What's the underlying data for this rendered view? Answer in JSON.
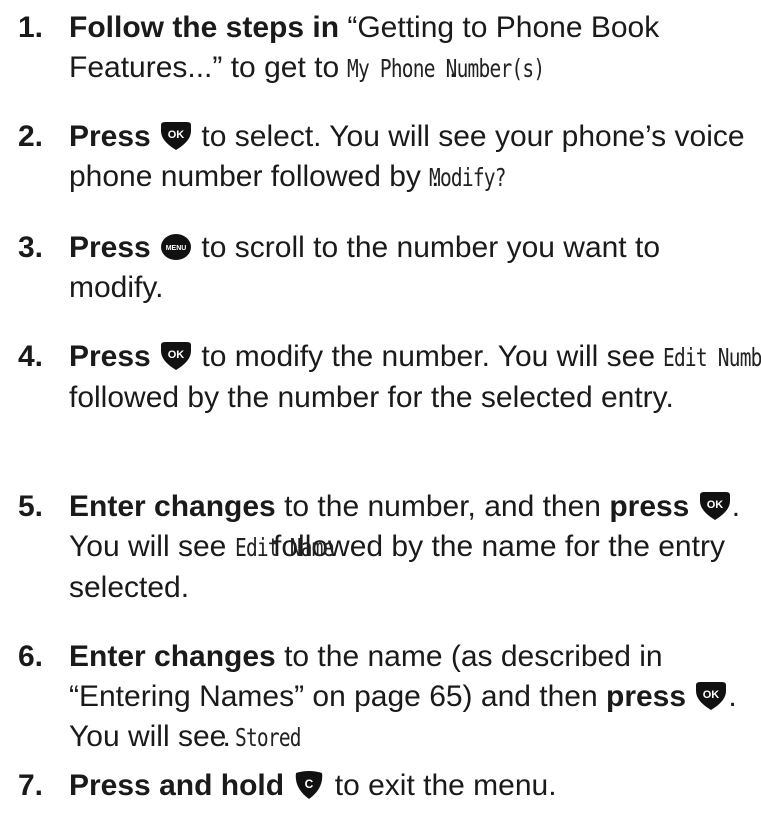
{
  "steps": [
    {
      "number": "1.",
      "bold": "Follow the steps in",
      "text_a": " “Getting to Phone Book Features...” to get to ",
      "lcd": "My Phone Number(s)",
      "text_b": "."
    },
    {
      "number": "2.",
      "bold": "Press",
      "icon": "ok-key-icon",
      "text_a": " to select. You will see your phone’s voice phone number followed by ",
      "lcd": "Modify?",
      "text_b": "."
    },
    {
      "number": "3.",
      "bold": "Press",
      "icon": "menu-key-icon",
      "text_a": " to scroll to the number you want to modify."
    },
    {
      "number": "4.",
      "bold": "Press",
      "icon": "ok-key-icon",
      "text_a": " to modify the number. You will see ",
      "lcd": "Edit Number",
      "text_b": " followed by the number for the selected entry."
    },
    {
      "number": "5.",
      "bold": "Enter changes",
      "text_a": " to the number, and then ",
      "bold2": "press",
      "icon": "ok-key-icon",
      "text_b": ". You will see ",
      "lcd": "Edit Name",
      "text_c": " followed by the name for the entry selected."
    },
    {
      "number": "6.",
      "bold": "Enter changes",
      "text_a": " to the name (as described in “Entering Names” on page 65) and then ",
      "bold2": "press",
      "icon": "ok-key-icon",
      "text_b": ". You will see ",
      "lcd": "Stored",
      "text_c": "."
    },
    {
      "number": "7.",
      "bold": "Press and hold",
      "icon": "clear-key-icon",
      "text_a": " to exit the menu."
    }
  ],
  "keys": {
    "ok": "OK",
    "menu": "MENU",
    "clear": "C"
  },
  "colors": {
    "text": "#1a1a1a",
    "key_fill": "#111111",
    "key_text": "#ffffff"
  }
}
